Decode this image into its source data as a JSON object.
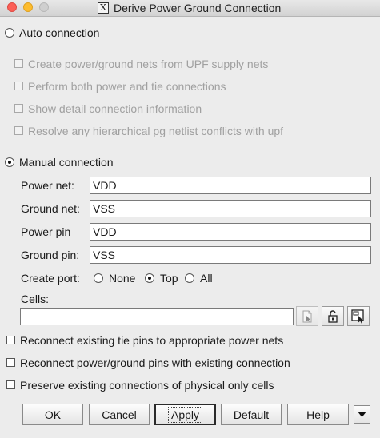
{
  "window": {
    "title": "Derive Power Ground Connection",
    "app_icon_glyph": "X"
  },
  "auto": {
    "label": "Auto connection",
    "selected": false,
    "options": [
      {
        "label": "Create power/ground nets from UPF supply nets",
        "checked": false,
        "enabled": false
      },
      {
        "label": "Perform both power and tie connections",
        "checked": false,
        "enabled": false
      },
      {
        "label": "Show detail connection information",
        "checked": false,
        "enabled": false
      },
      {
        "label": "Resolve any hierarchical pg netlist conflicts with upf",
        "checked": false,
        "enabled": false
      }
    ]
  },
  "manual": {
    "label": "Manual connection",
    "selected": true,
    "power_net": {
      "label": "Power net:",
      "value": "VDD"
    },
    "ground_net": {
      "label": "Ground net:",
      "value": "VSS"
    },
    "power_pin": {
      "label": "Power pin",
      "value": "VDD"
    },
    "ground_pin": {
      "label": "Ground pin:",
      "value": "VSS"
    },
    "create_port": {
      "label": "Create port:",
      "options": [
        {
          "label": "None",
          "selected": false
        },
        {
          "label": "Top",
          "selected": true
        },
        {
          "label": "All",
          "selected": false
        }
      ]
    },
    "cells": {
      "label": "Cells:",
      "value": ""
    }
  },
  "bottom_options": [
    {
      "label": "Reconnect existing tie pins to appropriate power nets",
      "checked": false
    },
    {
      "label": "Reconnect power/ground pins with existing connection",
      "checked": false
    },
    {
      "label": "Preserve existing connections of physical only cells",
      "checked": false
    }
  ],
  "buttons": {
    "ok": "OK",
    "cancel": "Cancel",
    "apply": "Apply",
    "default": "Default",
    "help": "Help"
  },
  "icons": {
    "cells_browse": "document-browse-icon",
    "cells_lock": "lock-icon",
    "cells_select": "select-window-icon",
    "more": "triangle-down-icon"
  }
}
